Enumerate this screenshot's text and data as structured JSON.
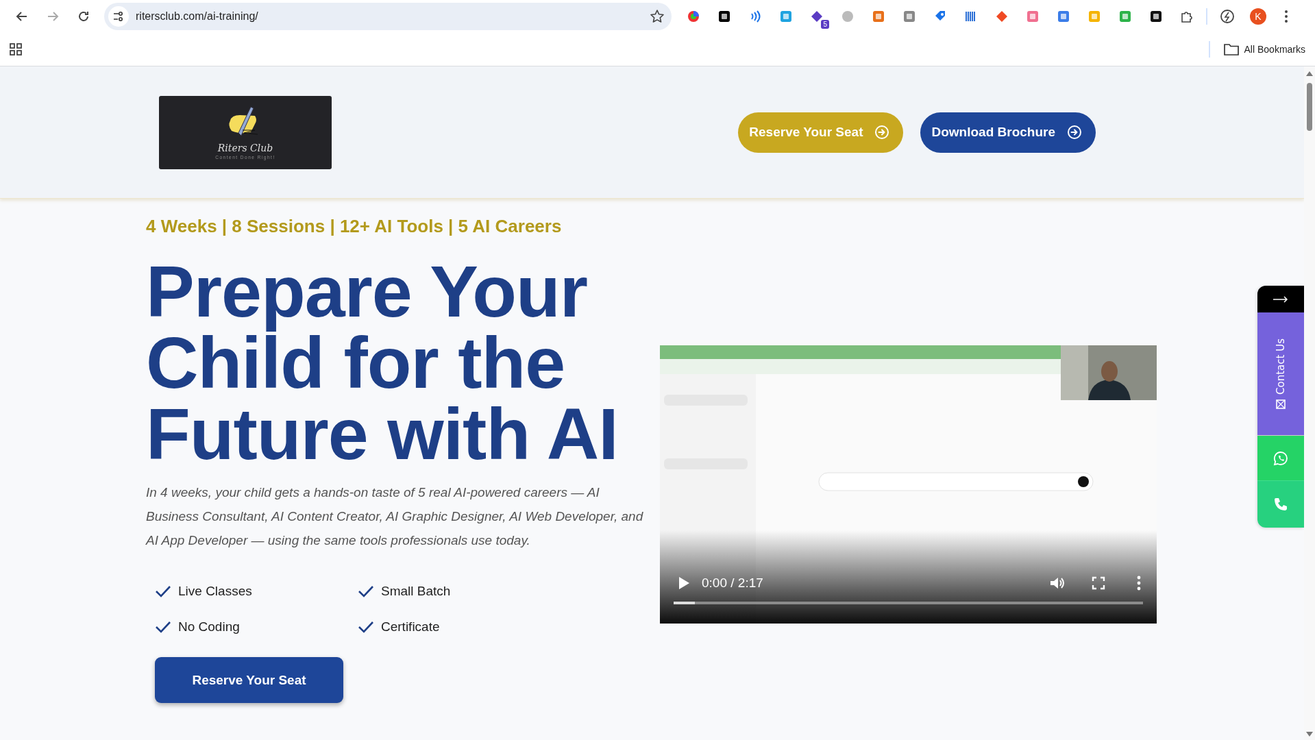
{
  "browser": {
    "url": "ritersclub.com/ai-training/",
    "extension_badge": "5",
    "profile_initial": "K",
    "bookmarks_label": "All Bookmarks"
  },
  "header": {
    "logo": {
      "name": "Riters Club",
      "tagline": "Content Done Right!"
    },
    "buttons": [
      {
        "label": "Reserve Your Seat",
        "kind": "gold"
      },
      {
        "label": "Download Brochure",
        "kind": "navy"
      }
    ]
  },
  "hero": {
    "tagline": "4 Weeks | 8 Sessions | 12+ AI Tools | 5 AI Careers",
    "heading": "Prepare Your Child for the Future with AI",
    "description": "In 4 weeks, your child gets a hands-on taste of 5 real AI-powered careers — AI Business Consultant, AI Content Creator, AI Graphic Designer, AI Web Developer, and AI App Developer — using the same tools professionals use today.",
    "features": [
      "Live Classes",
      "Small Batch",
      "No Coding",
      "Certificate"
    ],
    "cta": "Reserve Your Seat"
  },
  "video": {
    "time": "0:00 / 2:17",
    "progress": {
      "level": 0.045
    }
  },
  "contact_rail": {
    "label": "Contact Us"
  }
}
